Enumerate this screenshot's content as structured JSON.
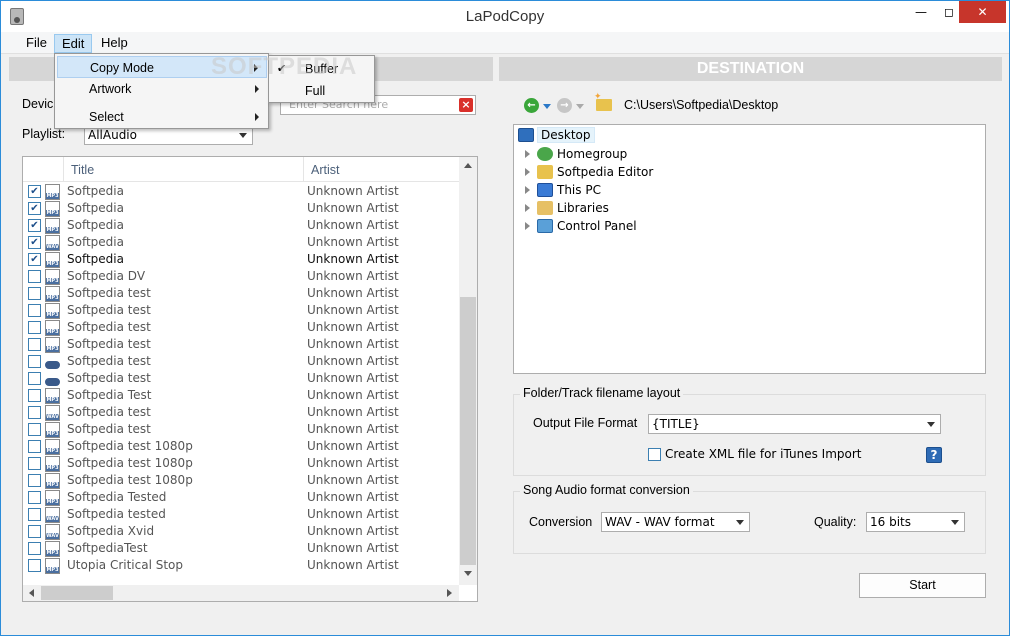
{
  "window": {
    "title": "LaPodCopy"
  },
  "menubar": {
    "file": "File",
    "edit": "Edit",
    "help": "Help"
  },
  "edit_menu": {
    "items": [
      {
        "label": "Copy Mode"
      },
      {
        "label": "Artwork"
      },
      {
        "label": "Select"
      }
    ],
    "copy_mode_submenu": [
      {
        "label": "Buffer",
        "checked": true
      },
      {
        "label": "Full",
        "checked": false
      }
    ]
  },
  "source": {
    "header": "",
    "device_label": "Devic",
    "playlist_label": "Playlist:",
    "playlist_value": "AllAudio",
    "search_placeholder": "Enter Search here",
    "columns": {
      "title": "Title",
      "artist": "Artist"
    },
    "tracks": [
      {
        "title": "Softpedia",
        "artist": "Unknown Artist",
        "checked": true,
        "type": "MP3"
      },
      {
        "title": "Softpedia",
        "artist": "Unknown Artist",
        "checked": true,
        "type": "MP3"
      },
      {
        "title": "Softpedia",
        "artist": "Unknown Artist",
        "checked": true,
        "type": "MP3"
      },
      {
        "title": "Softpedia",
        "artist": "Unknown Artist",
        "checked": true,
        "type": "WAV"
      },
      {
        "title": "Softpedia",
        "artist": "Unknown Artist",
        "checked": true,
        "type": "MP3"
      },
      {
        "title": "Softpedia DV",
        "artist": "Unknown Artist",
        "checked": false,
        "type": "MP3"
      },
      {
        "title": "Softpedia test",
        "artist": "Unknown Artist",
        "checked": false,
        "type": "MP3"
      },
      {
        "title": "Softpedia test",
        "artist": "Unknown Artist",
        "checked": false,
        "type": "MP3"
      },
      {
        "title": "Softpedia test",
        "artist": "Unknown Artist",
        "checked": false,
        "type": "MP3"
      },
      {
        "title": "Softpedia test",
        "artist": "Unknown Artist",
        "checked": false,
        "type": "MP3"
      },
      {
        "title": "Softpedia test",
        "artist": "Unknown Artist",
        "checked": false,
        "type": "VIDEO"
      },
      {
        "title": "Softpedia test",
        "artist": "Unknown Artist",
        "checked": false,
        "type": "VIDEO"
      },
      {
        "title": "Softpedia Test",
        "artist": "Unknown Artist",
        "checked": false,
        "type": "MP3"
      },
      {
        "title": "Softpedia test",
        "artist": "Unknown Artist",
        "checked": false,
        "type": "WAV"
      },
      {
        "title": "Softpedia test",
        "artist": "Unknown Artist",
        "checked": false,
        "type": "MP3"
      },
      {
        "title": "Softpedia test 1080p",
        "artist": "Unknown Artist",
        "checked": false,
        "type": "MP3"
      },
      {
        "title": "Softpedia test 1080p",
        "artist": "Unknown Artist",
        "checked": false,
        "type": "MP3"
      },
      {
        "title": "Softpedia test 1080p",
        "artist": "Unknown Artist",
        "checked": false,
        "type": "MP3"
      },
      {
        "title": "Softpedia Tested",
        "artist": "Unknown Artist",
        "checked": false,
        "type": "MP3"
      },
      {
        "title": "Softpedia tested",
        "artist": "Unknown Artist",
        "checked": false,
        "type": "WAV"
      },
      {
        "title": "Softpedia Xvid",
        "artist": "Unknown Artist",
        "checked": false,
        "type": "WAV"
      },
      {
        "title": "SoftpediaTest",
        "artist": "Unknown Artist",
        "checked": false,
        "type": "MP3"
      },
      {
        "title": "Utopia Critical Stop",
        "artist": "Unknown Artist",
        "checked": false,
        "type": "MP3"
      }
    ]
  },
  "destination": {
    "header": "DESTINATION",
    "path": "C:\\Users\\Softpedia\\Desktop",
    "tree": [
      {
        "label": "Desktop",
        "icon": "desktop-icon",
        "root": true
      },
      {
        "label": "Homegroup",
        "icon": "homegroup-icon"
      },
      {
        "label": "Softpedia Editor",
        "icon": "user-folder-icon"
      },
      {
        "label": "This PC",
        "icon": "computer-icon"
      },
      {
        "label": "Libraries",
        "icon": "libraries-icon"
      },
      {
        "label": "Control Panel",
        "icon": "control-panel-icon"
      }
    ],
    "layout_group": {
      "title": "Folder/Track filename layout",
      "output_format_label": "Output File Format",
      "output_format_value": "{TITLE}",
      "xml_checkbox_label": "Create XML file for iTunes Import"
    },
    "conversion_group": {
      "title": "Song Audio format conversion",
      "conversion_label": "Conversion",
      "conversion_value": "WAV - WAV format",
      "quality_label": "Quality:",
      "quality_value": "16 bits"
    },
    "start_button": "Start"
  },
  "watermark": "SOFTPEDIA",
  "colors": {
    "accent_blue": "#2b8cd9",
    "close_red": "#c7352b",
    "header_gray": "#d6d6d6",
    "menu_highlight": "#d3e7f9"
  }
}
